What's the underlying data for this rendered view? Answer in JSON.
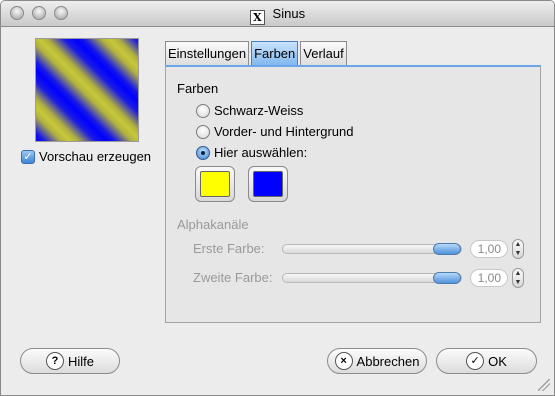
{
  "window": {
    "title": "Sinus"
  },
  "preview": {
    "checkbox_label": "Vorschau erzeugen",
    "checked": true
  },
  "tabs": [
    {
      "label": "Einstellungen",
      "active": false
    },
    {
      "label": "Farben",
      "active": true
    },
    {
      "label": "Verlauf",
      "active": false
    }
  ],
  "farben": {
    "section_title": "Farben",
    "options": [
      {
        "label": "Schwarz-Weiss",
        "selected": false
      },
      {
        "label": "Vorder- und Hintergrund",
        "selected": false
      },
      {
        "label": "Hier auswählen:",
        "selected": true
      }
    ],
    "color1": "#ffff00",
    "color2": "#0000ff"
  },
  "alpha": {
    "section_title": "Alphakanäle",
    "first": {
      "label": "Erste Farbe:",
      "value": "1,00"
    },
    "second": {
      "label": "Zweite Farbe:",
      "value": "1,00"
    }
  },
  "buttons": {
    "help": "Hilfe",
    "cancel": "Abbrechen",
    "ok": "OK"
  },
  "icons": {
    "help": "?",
    "cancel": "×",
    "ok": "✓",
    "app": "X"
  }
}
